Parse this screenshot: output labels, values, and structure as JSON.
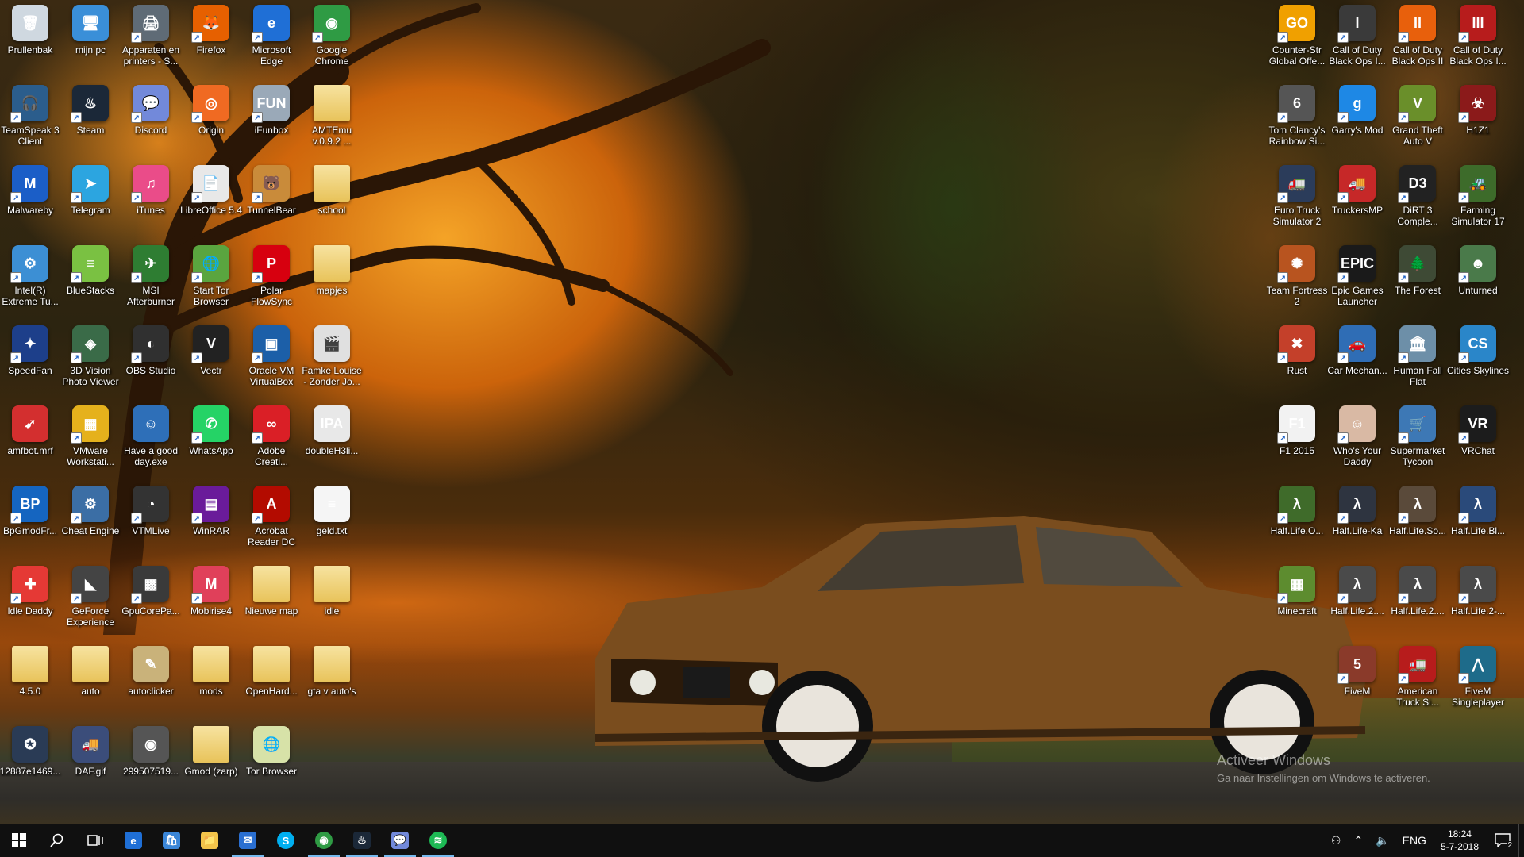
{
  "desktop": {
    "left_icons": [
      {
        "label": "Prullenbak",
        "icon": "recycle-bin-icon",
        "color": "#cfd8e0",
        "shortcut": false,
        "glyph": "🗑"
      },
      {
        "label": "mijn pc",
        "icon": "computer-icon",
        "color": "#3a8fd8",
        "shortcut": false,
        "glyph": "🖥"
      },
      {
        "label": "Apparaten en printers - S...",
        "icon": "printer-icon",
        "color": "#5f6b76",
        "shortcut": true,
        "glyph": "🖨"
      },
      {
        "label": "Firefox",
        "icon": "firefox-icon",
        "color": "#e66000",
        "shortcut": true,
        "glyph": "🦊"
      },
      {
        "label": "Microsoft Edge",
        "icon": "edge-icon",
        "color": "#1f6fd6",
        "shortcut": true,
        "glyph": "e"
      },
      {
        "label": "Google Chrome",
        "icon": "chrome-icon",
        "color": "#2f9b44",
        "shortcut": true,
        "glyph": "◉"
      },
      {
        "label": "TeamSpeak 3 Client",
        "icon": "teamspeak-icon",
        "color": "#2b5d8c",
        "shortcut": true,
        "glyph": "🎧"
      },
      {
        "label": "Steam",
        "icon": "steam-icon",
        "color": "#1b2838",
        "shortcut": true,
        "glyph": "♨"
      },
      {
        "label": "Discord",
        "icon": "discord-icon",
        "color": "#7289da",
        "shortcut": true,
        "glyph": "💬"
      },
      {
        "label": "Origin",
        "icon": "origin-icon",
        "color": "#f06a22",
        "shortcut": true,
        "glyph": "◎"
      },
      {
        "label": "iFunbox",
        "icon": "ifunbox-icon",
        "color": "#9aa9b8",
        "shortcut": true,
        "glyph": "FUN"
      },
      {
        "label": "AMTEmu v.0.9.2 ...",
        "icon": "folder-icon",
        "color": "#f3d784",
        "shortcut": false,
        "glyph": ""
      },
      {
        "label": "Malwareby",
        "icon": "malwarebytes-icon",
        "color": "#1b5ec7",
        "shortcut": true,
        "glyph": "M"
      },
      {
        "label": "Telegram",
        "icon": "telegram-icon",
        "color": "#2ca5e0",
        "shortcut": true,
        "glyph": "➤"
      },
      {
        "label": "iTunes",
        "icon": "itunes-icon",
        "color": "#ea4c89",
        "shortcut": true,
        "glyph": "♫"
      },
      {
        "label": "LibreOffice 5.4",
        "icon": "libreoffice-icon",
        "color": "#e8e8e8",
        "shortcut": true,
        "glyph": "📄"
      },
      {
        "label": "TunnelBear",
        "icon": "tunnelbear-icon",
        "color": "#c98b3a",
        "shortcut": true,
        "glyph": "🐻"
      },
      {
        "label": "school",
        "icon": "folder-icon",
        "color": "#f3d784",
        "shortcut": false,
        "glyph": ""
      },
      {
        "label": "Intel(R) Extreme Tu...",
        "icon": "intel-xtu-icon",
        "color": "#3c8fd4",
        "shortcut": true,
        "glyph": "⚙"
      },
      {
        "label": "BlueStacks",
        "icon": "bluestacks-icon",
        "color": "#7ac142",
        "shortcut": true,
        "glyph": "≡"
      },
      {
        "label": "MSI Afterburner",
        "icon": "msi-afterburner-icon",
        "color": "#2e7d32",
        "shortcut": true,
        "glyph": "✈"
      },
      {
        "label": "Start Tor Browser",
        "icon": "tor-browser-icon",
        "color": "#5aa53f",
        "shortcut": true,
        "glyph": "🌐"
      },
      {
        "label": "Polar FlowSync",
        "icon": "polar-icon",
        "color": "#d7000f",
        "shortcut": true,
        "glyph": "P"
      },
      {
        "label": "mapjes",
        "icon": "folder-icon",
        "color": "#f3d784",
        "shortcut": false,
        "glyph": ""
      },
      {
        "label": "SpeedFan",
        "icon": "speedfan-icon",
        "color": "#1d3f8a",
        "shortcut": true,
        "glyph": "✦"
      },
      {
        "label": "3D Vision Photo Viewer",
        "icon": "3d-vision-icon",
        "color": "#3a6b48",
        "shortcut": true,
        "glyph": "◈"
      },
      {
        "label": "OBS Studio",
        "icon": "obs-icon",
        "color": "#303030",
        "shortcut": true,
        "glyph": "◐"
      },
      {
        "label": "Vectr",
        "icon": "vectr-icon",
        "color": "#222222",
        "shortcut": true,
        "glyph": "V"
      },
      {
        "label": "Oracle VM VirtualBox",
        "icon": "virtualbox-icon",
        "color": "#1c5fa8",
        "shortcut": true,
        "glyph": "▣"
      },
      {
        "label": "Famke Louise - Zonder Jo...",
        "icon": "video-file-icon",
        "color": "#e0e0e0",
        "shortcut": false,
        "glyph": "🎬"
      },
      {
        "label": "amfbot.mrf",
        "icon": "amfbot-icon",
        "color": "#d32f2f",
        "shortcut": false,
        "glyph": "➹"
      },
      {
        "label": "VMware Workstati...",
        "icon": "vmware-icon",
        "color": "#e5b11c",
        "shortcut": true,
        "glyph": "▦"
      },
      {
        "label": "Have a good day.exe",
        "icon": "exe-icon",
        "color": "#2e6fb8",
        "shortcut": false,
        "glyph": "☺"
      },
      {
        "label": "WhatsApp",
        "icon": "whatsapp-icon",
        "color": "#25d366",
        "shortcut": true,
        "glyph": "✆"
      },
      {
        "label": "Adobe Creati...",
        "icon": "adobe-cc-icon",
        "color": "#da1f26",
        "shortcut": true,
        "glyph": "∞"
      },
      {
        "label": "doubleH3li...",
        "icon": "ipa-file-icon",
        "color": "#e8e8e8",
        "shortcut": false,
        "glyph": "IPA"
      },
      {
        "label": "BpGmodFr...",
        "icon": "bp-icon",
        "color": "#1565c0",
        "shortcut": true,
        "glyph": "BP"
      },
      {
        "label": "Cheat Engine",
        "icon": "cheat-engine-icon",
        "color": "#3b6ea5",
        "shortcut": true,
        "glyph": "⚙"
      },
      {
        "label": "VTMLive",
        "icon": "vtmlive-icon",
        "color": "#333333",
        "shortcut": true,
        "glyph": "◔"
      },
      {
        "label": "WinRAR",
        "icon": "winrar-icon",
        "color": "#6a1b9a",
        "shortcut": true,
        "glyph": "▤"
      },
      {
        "label": "Acrobat Reader DC",
        "icon": "acrobat-icon",
        "color": "#b30b00",
        "shortcut": true,
        "glyph": "A"
      },
      {
        "label": "geld.txt",
        "icon": "text-file-icon",
        "color": "#f5f5f5",
        "shortcut": false,
        "glyph": "≡"
      },
      {
        "label": "Idle Daddy",
        "icon": "idle-daddy-icon",
        "color": "#e53935",
        "shortcut": true,
        "glyph": "✚"
      },
      {
        "label": "GeForce Experience",
        "icon": "geforce-icon",
        "color": "#444444",
        "shortcut": true,
        "glyph": "◣"
      },
      {
        "label": "GpuCorePa...",
        "icon": "gpu-icon",
        "color": "#3a3a3a",
        "shortcut": true,
        "glyph": "▩"
      },
      {
        "label": "Mobirise4",
        "icon": "mobirise-icon",
        "color": "#e0405a",
        "shortcut": true,
        "glyph": "M"
      },
      {
        "label": "Nieuwe map",
        "icon": "folder-icon",
        "color": "#f3d784",
        "shortcut": false,
        "glyph": ""
      },
      {
        "label": "idle",
        "icon": "folder-icon",
        "color": "#f3d784",
        "shortcut": false,
        "glyph": ""
      },
      {
        "label": "4.5.0",
        "icon": "folder-icon",
        "color": "#f3d784",
        "shortcut": false,
        "glyph": ""
      },
      {
        "label": "auto",
        "icon": "folder-icon",
        "color": "#f3d784",
        "shortcut": false,
        "glyph": ""
      },
      {
        "label": "autoclicker",
        "icon": "autoclicker-icon",
        "color": "#c9b27a",
        "shortcut": false,
        "glyph": "✎"
      },
      {
        "label": "mods",
        "icon": "folder-icon",
        "color": "#f3d784",
        "shortcut": false,
        "glyph": ""
      },
      {
        "label": "OpenHard...",
        "icon": "folder-icon",
        "color": "#f3d784",
        "shortcut": false,
        "glyph": ""
      },
      {
        "label": "gta v auto's",
        "icon": "folder-icon",
        "color": "#f3d784",
        "shortcut": false,
        "glyph": ""
      },
      {
        "label": "12887e1469...",
        "icon": "image-file-icon",
        "color": "#2a3b55",
        "shortcut": false,
        "glyph": "✪"
      },
      {
        "label": "DAF.gif",
        "icon": "gif-file-icon",
        "color": "#3b4d7a",
        "shortcut": false,
        "glyph": "🚚"
      },
      {
        "label": "299507519...",
        "icon": "image-file-icon",
        "color": "#555555",
        "shortcut": false,
        "glyph": "◉"
      },
      {
        "label": "Gmod (zarp)",
        "icon": "folder-icon",
        "color": "#f3d784",
        "shortcut": false,
        "glyph": ""
      },
      {
        "label": "Tor Browser",
        "icon": "tor-folder-icon",
        "color": "#d7e2a8",
        "shortcut": false,
        "glyph": "🌐"
      }
    ],
    "right_icons": [
      {
        "label": "Counter-Str Global Offe...",
        "icon": "csgo-icon",
        "color": "#f0a000",
        "glyph": "GO"
      },
      {
        "label": "Call of Duty Black Ops I...",
        "icon": "cod-bo-icon",
        "color": "#3a3a3a",
        "glyph": "I"
      },
      {
        "label": "Call of Duty Black Ops II",
        "icon": "cod-bo2-icon",
        "color": "#e8600c",
        "glyph": "II"
      },
      {
        "label": "Call of Duty Black Ops I...",
        "icon": "cod-bo3-icon",
        "color": "#b71c1c",
        "glyph": "III"
      },
      {
        "label": "Tom Clancy's Rainbow Si...",
        "icon": "rainbow-six-icon",
        "color": "#555555",
        "glyph": "6"
      },
      {
        "label": "Garry's Mod",
        "icon": "garrys-mod-icon",
        "color": "#1e88e5",
        "glyph": "g"
      },
      {
        "label": "Grand Theft Auto V",
        "icon": "gta-v-icon",
        "color": "#6a8f2a",
        "glyph": "V"
      },
      {
        "label": "H1Z1",
        "icon": "h1z1-icon",
        "color": "#8b1a1a",
        "glyph": "☣"
      },
      {
        "label": "Euro Truck Simulator 2",
        "icon": "ets2-icon",
        "color": "#2b3c5a",
        "glyph": "🚛"
      },
      {
        "label": "TruckersMP",
        "icon": "truckersmp-icon",
        "color": "#c62828",
        "glyph": "🚚"
      },
      {
        "label": "DiRT 3 Comple...",
        "icon": "dirt3-icon",
        "color": "#222222",
        "glyph": "D3"
      },
      {
        "label": "Farming Simulator 17",
        "icon": "farming-sim-icon",
        "color": "#3d6b2a",
        "glyph": "🚜"
      },
      {
        "label": "Team Fortress 2",
        "icon": "tf2-icon",
        "color": "#b8541f",
        "glyph": "✺"
      },
      {
        "label": "Epic Games Launcher",
        "icon": "epic-games-icon",
        "color": "#1a1a1a",
        "glyph": "EPIC"
      },
      {
        "label": "The Forest",
        "icon": "the-forest-icon",
        "color": "#3e4a35",
        "glyph": "🌲"
      },
      {
        "label": "Unturned",
        "icon": "unturned-icon",
        "color": "#4a7a4a",
        "glyph": "☻"
      },
      {
        "label": "Rust",
        "icon": "rust-icon",
        "color": "#c4402a",
        "glyph": "✖"
      },
      {
        "label": "Car Mechan...",
        "icon": "car-mechanic-icon",
        "color": "#2f6db5",
        "glyph": "🚗"
      },
      {
        "label": "Human Fall Flat",
        "icon": "human-fall-flat-icon",
        "color": "#6d8fa8",
        "glyph": "🏛"
      },
      {
        "label": "Cities Skylines",
        "icon": "cities-skylines-icon",
        "color": "#2a86c9",
        "glyph": "CS"
      },
      {
        "label": "F1 2015",
        "icon": "f1-2015-icon",
        "color": "#f2f2f2",
        "glyph": "F1"
      },
      {
        "label": "Who's Your Daddy",
        "icon": "whos-your-daddy-icon",
        "color": "#d9b9a4",
        "glyph": "☺"
      },
      {
        "label": "Supermarket Tycoon",
        "icon": "supermarket-tycoon-icon",
        "color": "#3d78b5",
        "glyph": "🛒"
      },
      {
        "label": "VRChat",
        "icon": "vrchat-icon",
        "color": "#1c1c1c",
        "glyph": "VR"
      },
      {
        "label": "Half.Life.O...",
        "icon": "half-life-icon",
        "color": "#3f6b2a",
        "glyph": "λ"
      },
      {
        "label": "Half.Life-Ka",
        "icon": "half-life-icon",
        "color": "#2e3440",
        "glyph": "λ"
      },
      {
        "label": "Half.Life.So...",
        "icon": "half-life-icon",
        "color": "#5a4a3a",
        "glyph": "λ"
      },
      {
        "label": "Half.Life.Bl...",
        "icon": "half-life-icon",
        "color": "#2a4a7a",
        "glyph": "λ"
      },
      {
        "label": "Minecraft",
        "icon": "minecraft-icon",
        "color": "#5d8c2f",
        "glyph": "▦"
      },
      {
        "label": "Half.Life.2....",
        "icon": "half-life-2-icon",
        "color": "#4a4a4a",
        "glyph": "λ"
      },
      {
        "label": "Half.Life.2....",
        "icon": "half-life-2-icon",
        "color": "#4a4a4a",
        "glyph": "λ"
      },
      {
        "label": "Half.Life.2-...",
        "icon": "half-life-2-icon",
        "color": "#4a4a4a",
        "glyph": "λ"
      },
      {
        "label": "FiveM",
        "icon": "fivem-icon",
        "color": "#8a3a2a",
        "glyph": "5"
      },
      {
        "label": "American Truck Si...",
        "icon": "ats-icon",
        "color": "#b71c1c",
        "glyph": "🚛"
      },
      {
        "label": "FiveM Singleplayer",
        "icon": "fivem-sp-icon",
        "color": "#1e6b8a",
        "glyph": "⋀"
      }
    ]
  },
  "watermark": {
    "title": "Activeer Windows",
    "subtitle": "Ga naar Instellingen om Windows te activeren."
  },
  "taskbar": {
    "apps": [
      {
        "name": "edge",
        "icon": "edge-icon",
        "color": "#1f6fd6",
        "glyph": "e",
        "active": false
      },
      {
        "name": "store",
        "icon": "store-icon",
        "color": "#3a86d8",
        "glyph": "🛍",
        "active": false
      },
      {
        "name": "explorer",
        "icon": "file-explorer-icon",
        "color": "#f3c44a",
        "glyph": "📁",
        "active": false
      },
      {
        "name": "mail",
        "icon": "mail-icon",
        "color": "#2a6fd1",
        "glyph": "✉",
        "active": true
      },
      {
        "name": "skype",
        "icon": "skype-icon",
        "color": "#00aff0",
        "glyph": "S",
        "active": false
      },
      {
        "name": "chrome",
        "icon": "chrome-icon",
        "color": "#2f9b44",
        "glyph": "◉",
        "active": true
      },
      {
        "name": "steam",
        "icon": "steam-icon",
        "color": "#1b2838",
        "glyph": "♨",
        "active": true
      },
      {
        "name": "discord",
        "icon": "discord-icon",
        "color": "#7289da",
        "glyph": "💬",
        "active": true
      },
      {
        "name": "spotify",
        "icon": "spotify-icon",
        "color": "#1db954",
        "glyph": "≋",
        "active": true
      }
    ],
    "tray": {
      "language": "ENG",
      "time": "18:24",
      "date": "5-7-2018",
      "notification_count": "2"
    }
  }
}
